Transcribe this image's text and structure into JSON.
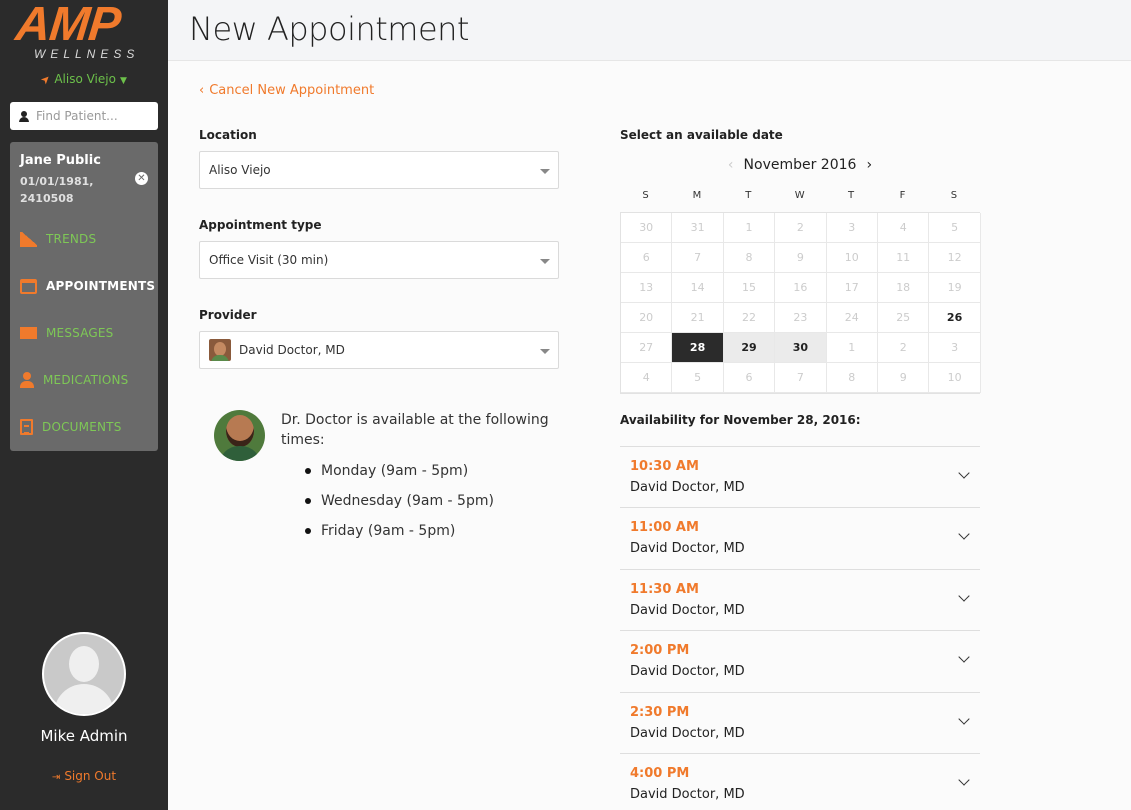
{
  "brand": {
    "logo_main": "AMP",
    "logo_sub": "WELLNESS",
    "orange": "#f07a2c",
    "green": "#7ec856"
  },
  "sidebar": {
    "location": "Aliso Viejo",
    "search_placeholder": "Find Patient...",
    "patient": {
      "name": "Jane Public",
      "dob": "01/01/1981,",
      "id": "2410508"
    },
    "nav": [
      {
        "label": "TRENDS",
        "icon": "chart-area-icon",
        "active": false
      },
      {
        "label": "APPOINTMENTS",
        "icon": "calendar-icon",
        "active": true
      },
      {
        "label": "MESSAGES",
        "icon": "envelope-icon",
        "active": false
      },
      {
        "label": "MEDICATIONS",
        "icon": "user-md-icon",
        "active": false
      },
      {
        "label": "DOCUMENTS",
        "icon": "document-icon",
        "active": false
      }
    ],
    "user_name": "Mike Admin",
    "signout_label": "Sign Out"
  },
  "header": {
    "title": "New Appointment"
  },
  "form": {
    "cancel_label": "Cancel New Appointment",
    "location_label": "Location",
    "location_value": "Aliso Viejo",
    "type_label": "Appointment type",
    "type_value": "Office Visit (30 min)",
    "provider_label": "Provider",
    "provider_value": "David Doctor, MD",
    "availability_intro": "Dr. Doctor is available at the following times:",
    "availability_days": [
      "Monday (9am - 5pm)",
      "Wednesday (9am - 5pm)",
      "Friday (9am - 5pm)"
    ]
  },
  "calendar": {
    "label": "Select an available date",
    "month": "November 2016",
    "weekdays": [
      "S",
      "M",
      "T",
      "W",
      "T",
      "F",
      "S"
    ],
    "weeks": [
      [
        "30",
        "31",
        "1",
        "2",
        "3",
        "4",
        "5"
      ],
      [
        "6",
        "7",
        "8",
        "9",
        "10",
        "11",
        "12"
      ],
      [
        "13",
        "14",
        "15",
        "16",
        "17",
        "18",
        "19"
      ],
      [
        "20",
        "21",
        "22",
        "23",
        "24",
        "25",
        "26"
      ],
      [
        "27",
        "28",
        "29",
        "30",
        "1",
        "2",
        "3"
      ],
      [
        "4",
        "5",
        "6",
        "7",
        "8",
        "9",
        "10"
      ]
    ],
    "available": [
      "3-6",
      "4-1",
      "4-2",
      "4-3"
    ],
    "selected": "4-1",
    "highlighted": [
      "4-2",
      "4-3"
    ]
  },
  "availability": {
    "title": "Availability for November 28, 2016:",
    "slots": [
      {
        "time": "10:30 AM",
        "provider": "David Doctor, MD"
      },
      {
        "time": "11:00 AM",
        "provider": "David Doctor, MD"
      },
      {
        "time": "11:30 AM",
        "provider": "David Doctor, MD"
      },
      {
        "time": "2:00 PM",
        "provider": "David Doctor, MD"
      },
      {
        "time": "2:30 PM",
        "provider": "David Doctor, MD"
      },
      {
        "time": "4:00 PM",
        "provider": "David Doctor, MD"
      }
    ]
  }
}
